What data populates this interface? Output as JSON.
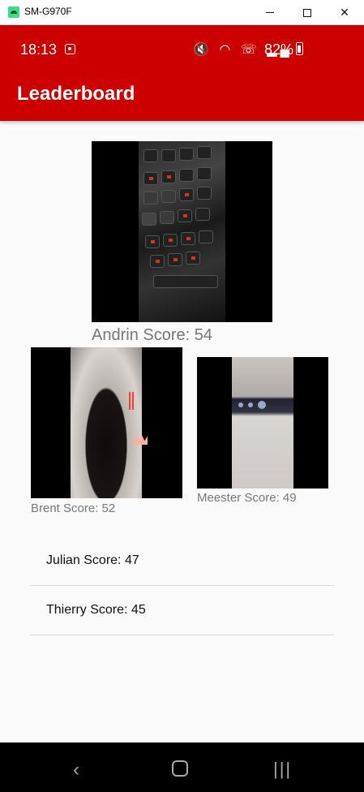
{
  "window": {
    "title": "SM-G970F"
  },
  "status_bar": {
    "time": "18:13",
    "battery": "82%",
    "icons": "🔇 ◠ ☏ ▂▄"
  },
  "app_bar": {
    "title": "Leaderboard"
  },
  "podium": [
    {
      "name": "Andrin",
      "caption": "Andrin Score: 54",
      "score": 54
    },
    {
      "name": "Brent",
      "caption": "Brent Score: 52",
      "score": 52
    },
    {
      "name": "Meester",
      "caption": "Meester Score: 49",
      "score": 49
    }
  ],
  "list": [
    {
      "label": "Julian Score: 47",
      "score": 47
    },
    {
      "label": "Thierry Score: 45",
      "score": 45
    }
  ],
  "colors": {
    "primary": "#cc0000",
    "background": "#fafafa",
    "caption": "#777777"
  },
  "nav": {
    "back": "‹",
    "recent": "|||"
  }
}
